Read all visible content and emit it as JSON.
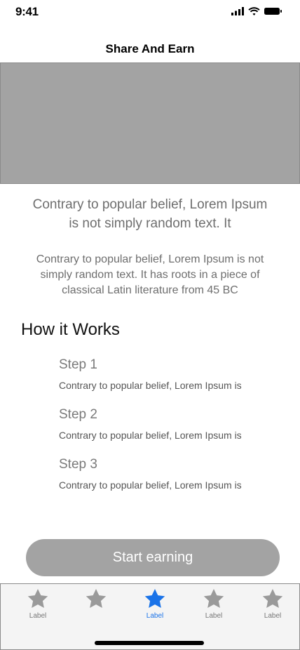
{
  "status_bar": {
    "time": "9:41",
    "icons": [
      "signal-icon",
      "wifi-icon",
      "battery-icon"
    ]
  },
  "header": {
    "title": "Share And Earn"
  },
  "headline": "Contrary to popular belief, Lorem Ipsum is not simply random text. It",
  "subtext": "Contrary to popular belief, Lorem Ipsum is not simply random text. It has roots in a piece of classical Latin literature from 45 BC",
  "how_it_works": {
    "title": "How it Works",
    "steps": [
      {
        "title": "Step 1",
        "description": "Contrary to popular belief, Lorem Ipsum is"
      },
      {
        "title": "Step 2",
        "description": "Contrary to popular belief, Lorem Ipsum is"
      },
      {
        "title": "Step 3",
        "description": "Contrary to popular belief, Lorem Ipsum is"
      }
    ]
  },
  "cta": {
    "label": "Start earning"
  },
  "tab_bar": {
    "tabs": [
      {
        "label": "Label",
        "icon": "star-icon",
        "active": false
      },
      {
        "label": "",
        "icon": "star-icon",
        "active": false
      },
      {
        "label": "Label",
        "icon": "star-icon",
        "active": true
      },
      {
        "label": "Label",
        "icon": "star-icon",
        "active": false
      },
      {
        "label": "Label",
        "icon": "star-icon",
        "active": false
      }
    ]
  },
  "colors": {
    "placeholder_gray": "#a3a3a3",
    "active_tab": "#1a73e8",
    "inactive_tab": "#9a9a9a"
  }
}
